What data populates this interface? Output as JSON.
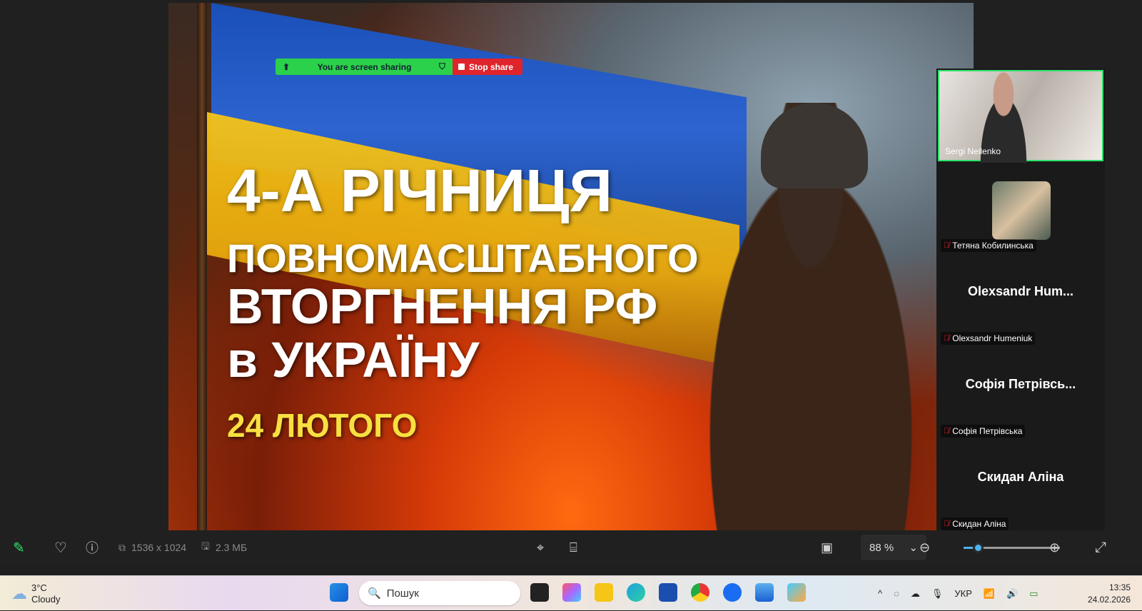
{
  "slide": {
    "line1": "4-А РІЧНИЦЯ",
    "line2": "ПОВНОМАСШТАБНОГО",
    "line3": "ВТОРГНЕННЯ РФ",
    "line4": "в УКРАЇНУ",
    "date": "24 ЛЮТОГО"
  },
  "share_bar": {
    "status": "You are screen sharing",
    "stop": "Stop share"
  },
  "participants": [
    {
      "name": "Sergi Neilenko",
      "video": true
    },
    {
      "name": "Тетяна Кобилинська",
      "muted": true
    },
    {
      "display": "Olexsandr  Hum...",
      "name": "Olexsandr Humeniuk",
      "muted": true
    },
    {
      "display": "Софія  Петрівсь...",
      "name": "Софія Петрівська",
      "muted": true
    },
    {
      "display": "Скидан Аліна",
      "name": "Скидан Аліна",
      "muted": true
    }
  ],
  "toolbar": {
    "dimensions": "1536 x 1024",
    "size": "2.3 МБ",
    "zoom": "88 %",
    "zoom_fraction": 0.15
  },
  "taskbar": {
    "temp": "3°C",
    "weather": "Cloudy",
    "search_placeholder": "Пошук",
    "lang": "УКР",
    "time": "13:35",
    "date": "24.02.2026"
  },
  "colors": {
    "share_green": "#2bd14a",
    "stop_red": "#e0242c",
    "active_border": "#2ee26a",
    "accent": "#4fb3f0"
  }
}
